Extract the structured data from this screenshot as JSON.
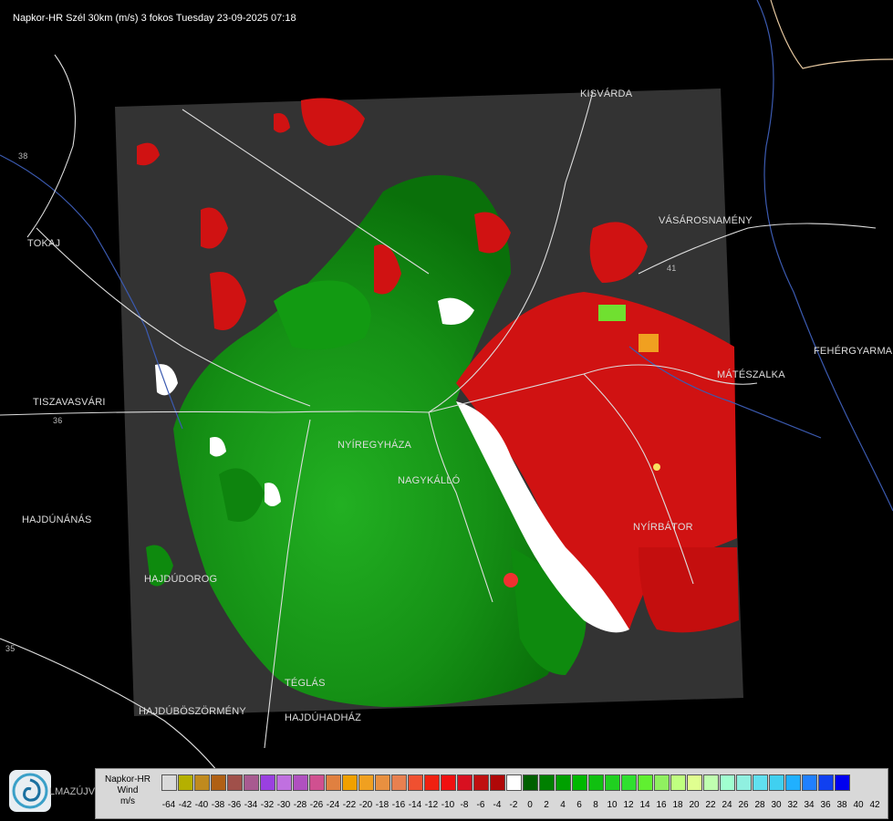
{
  "header": {
    "title": "Napkor-HR Szél 30km (m/s) 3 fokos Tuesday 23-09-2025 07:18"
  },
  "cities": [
    {
      "id": "kisvarda",
      "name": "KISVÁRDA"
    },
    {
      "id": "tokaj",
      "name": "TOKAJ"
    },
    {
      "id": "vasarosnameny",
      "name": "VÁSÁROSNAMÉNY"
    },
    {
      "id": "fehergyarmat",
      "name": "FEHÉRGYARMA"
    },
    {
      "id": "mateszalka",
      "name": "MÁTÉSZALKA"
    },
    {
      "id": "tiszavasvari",
      "name": "TISZAVASVÁRI"
    },
    {
      "id": "nyiregyhaza",
      "name": "NYÍREGYHÁZA"
    },
    {
      "id": "nagykallo",
      "name": "NAGYKÁLLÓ"
    },
    {
      "id": "hajdunanas",
      "name": "HAJDÚNÁNÁS"
    },
    {
      "id": "nyirbator",
      "name": "NYÍRBÁTOR"
    },
    {
      "id": "hajdudorog",
      "name": "HAJDÚDOROG"
    },
    {
      "id": "teglas",
      "name": "TÉGLÁS"
    },
    {
      "id": "hajduboszormeny",
      "name": "HAJDÚBÖSZÖRMÉNY"
    },
    {
      "id": "hajduhadhaz",
      "name": "HAJDÚHADHÁZ"
    }
  ],
  "road_labels": {
    "r41": "41",
    "r36": "36",
    "r35": "35",
    "r38": "38"
  },
  "logo": {
    "text": "LMAZÚJVÁR"
  },
  "legend": {
    "label_lines": [
      "Napkor-HR",
      "Wind",
      "m/s"
    ],
    "colors": [
      "#d9d9d9",
      "#b5b000",
      "#c08a1e",
      "#b06014",
      "#a0504a",
      "#a85a90",
      "#9a40e0",
      "#c070e0",
      "#b050c0",
      "#d05090",
      "#e08040",
      "#f0a000",
      "#f0a020",
      "#e89040",
      "#e88050",
      "#f05030",
      "#f02010",
      "#f01010",
      "#d81020",
      "#c01010",
      "#b00808",
      "#ffffff",
      "#006000",
      "#008000",
      "#00a000",
      "#00b800",
      "#10c010",
      "#20d020",
      "#30e030",
      "#60f030",
      "#90f060",
      "#c0ff80",
      "#e0ff90",
      "#c0ffb0",
      "#a0ffd0",
      "#90f0e0",
      "#60e0f0",
      "#40d0f0",
      "#20b0ff",
      "#2080ff",
      "#1040f0",
      "#0000f0"
    ],
    "ticks": [
      "-64",
      "-42",
      "-40",
      "-38",
      "-36",
      "-34",
      "-32",
      "-30",
      "-28",
      "-26",
      "-24",
      "-22",
      "-20",
      "-18",
      "-16",
      "-14",
      "-12",
      "-10",
      "-8",
      "-6",
      "-4",
      "-2",
      "0",
      "2",
      "4",
      "6",
      "8",
      "10",
      "12",
      "14",
      "16",
      "18",
      "20",
      "22",
      "24",
      "26",
      "28",
      "30",
      "32",
      "34",
      "36",
      "38",
      "40",
      "42"
    ]
  }
}
